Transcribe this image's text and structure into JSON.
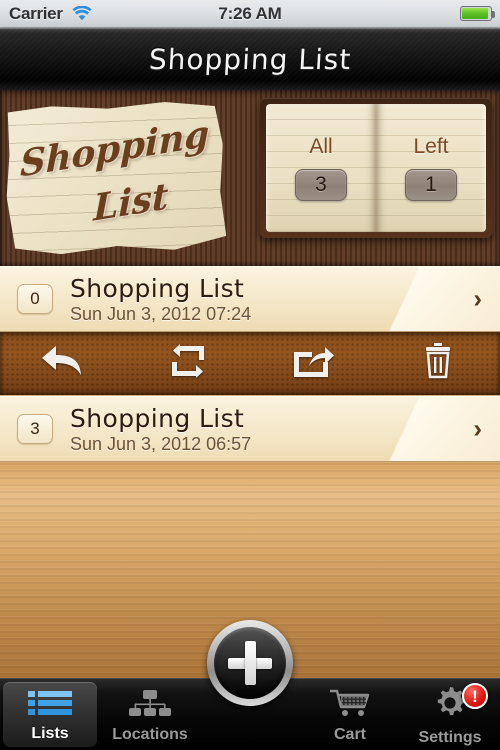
{
  "status_bar": {
    "carrier": "Carrier",
    "time": "7:26 AM",
    "wifi_icon": "wifi-icon",
    "battery_icon": "battery-icon"
  },
  "nav_bar": {
    "title": "Shopping List"
  },
  "header": {
    "note": {
      "line1": "Shopping",
      "line2": "List"
    },
    "counters": [
      {
        "label": "All",
        "count": "3"
      },
      {
        "label": "Left",
        "count": "1"
      }
    ]
  },
  "lists": [
    {
      "badge": "0",
      "title": "Shopping List",
      "subtitle": "Sun Jun 3, 2012 07:24",
      "chevron": "›",
      "expanded": true
    },
    {
      "badge": "3",
      "title": "Shopping List",
      "subtitle": "Sun Jun 3, 2012 06:57",
      "chevron": "›",
      "expanded": false
    }
  ],
  "action_bar": {
    "actions": [
      {
        "name": "reply-icon",
        "label": "Reply"
      },
      {
        "name": "repeat-icon",
        "label": "Repeat"
      },
      {
        "name": "share-icon",
        "label": "Share"
      },
      {
        "name": "trash-icon",
        "label": "Delete"
      }
    ]
  },
  "tab_bar": {
    "tabs": [
      {
        "label": "Lists",
        "icon": "list-icon",
        "active": true
      },
      {
        "label": "Locations",
        "icon": "hierarchy-icon",
        "active": false
      },
      {
        "label": "",
        "icon": "add-icon",
        "active": false
      },
      {
        "label": "Cart",
        "icon": "cart-icon",
        "active": false
      },
      {
        "label": "Settings",
        "icon": "gear-icon",
        "active": false,
        "badge": "!"
      }
    ],
    "add_button": {
      "name": "add-button",
      "glyph": "+"
    }
  },
  "colors": {
    "accent_blue": "#4aa3e8",
    "wood_brown": "#8d5a26",
    "paper_cream": "#f3ecd6",
    "badge_red": "#e01a14"
  }
}
